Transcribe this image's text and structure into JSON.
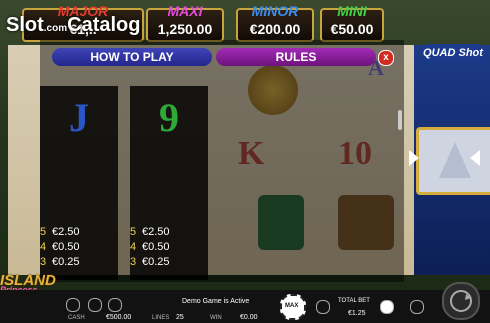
{
  "watermark": {
    "text": "Slot",
    "dot": ".com",
    "text2": "Catalog"
  },
  "jackpots": [
    {
      "label": "MAJOR",
      "value": "€1,..",
      "color": "#e43b2f"
    },
    {
      "label": "MAXI",
      "value": "1,250.00",
      "color": "#e54be0"
    },
    {
      "label": "MINOR",
      "value": "€200.00",
      "color": "#3d8df0"
    },
    {
      "label": "MINI",
      "value": "€50.00",
      "color": "#3fd24a"
    }
  ],
  "panel": {
    "tab_how": "HOW TO PLAY",
    "tab_rules": "RULES",
    "close": "x"
  },
  "cards": [
    {
      "symbol": "J",
      "color": "#2a56c8",
      "pays": [
        {
          "n": "5",
          "v": "€2.50"
        },
        {
          "n": "4",
          "v": "€0.50"
        },
        {
          "n": "3",
          "v": "€0.25"
        }
      ]
    },
    {
      "symbol": "9",
      "color": "#2faa37",
      "pays": [
        {
          "n": "5",
          "v": "€2.50"
        },
        {
          "n": "4",
          "v": "€0.50"
        },
        {
          "n": "3",
          "v": "€0.25"
        }
      ]
    }
  ],
  "reel_symbols": {
    "k": "K",
    "ten": "10",
    "a": "A"
  },
  "side_logo": "QUAD Shot",
  "island_logo": {
    "line1": "ISLAND",
    "line2": "Princess"
  },
  "bottom": {
    "cash_label": "CASH",
    "cash_value": "€500.00",
    "lines_label": "LINES",
    "lines_value": "25",
    "win_label": "WIN",
    "win_value": "€0.00",
    "status": "Demo Game is Active",
    "total_bet_label": "TOTAL BET",
    "total_bet_value": "€1.25",
    "max_label": "MAX"
  }
}
